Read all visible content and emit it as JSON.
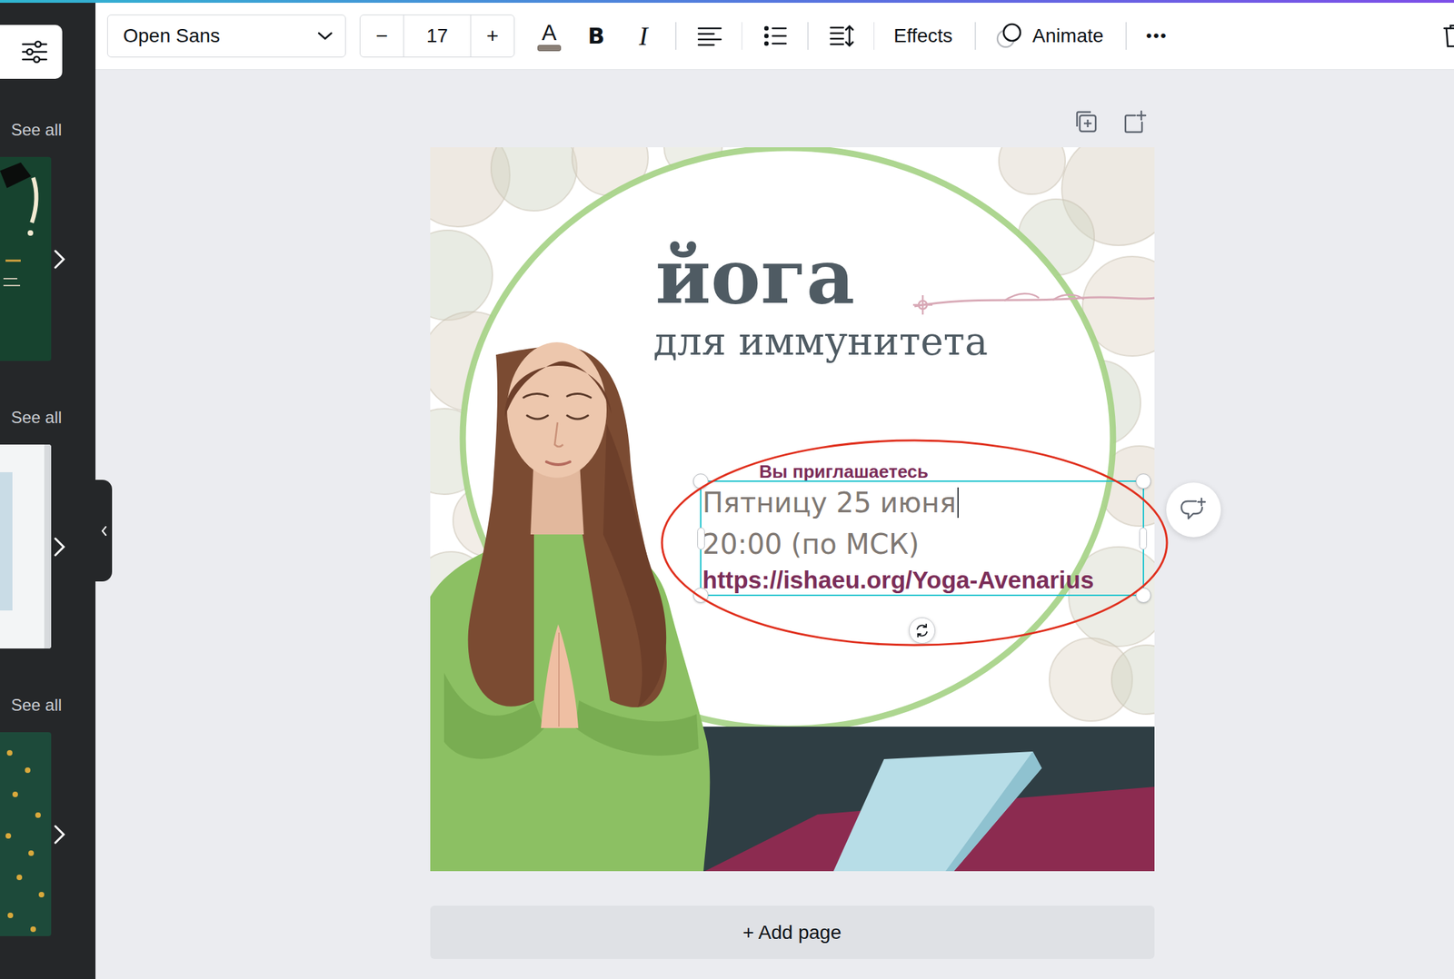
{
  "toolbar": {
    "font": "Open Sans",
    "font_size": {
      "decrease": "−",
      "value": "17",
      "increase": "+"
    },
    "text_color": "A",
    "bold": "B",
    "italic": "I",
    "effects": "Effects",
    "animate": "Animate",
    "more": "•••"
  },
  "sidebar": {
    "sections": [
      {
        "see_all": "See all",
        "kind": "graduation"
      },
      {
        "see_all": "See all",
        "kind": "photo"
      },
      {
        "see_all": "See all",
        "kind": "dots"
      }
    ]
  },
  "design": {
    "title": "йога",
    "subtitle": "для иммунитета",
    "invite": "Вы приглашаетесь",
    "selected_text": {
      "selected": true,
      "highlighted": true,
      "caret_line": 0,
      "lines": [
        "Пятницу 25 июня",
        "20:00 (по МСК)"
      ],
      "link": "https://ishaeu.org/Yoga-Avenarius"
    }
  },
  "add_page": "+ Add page"
}
